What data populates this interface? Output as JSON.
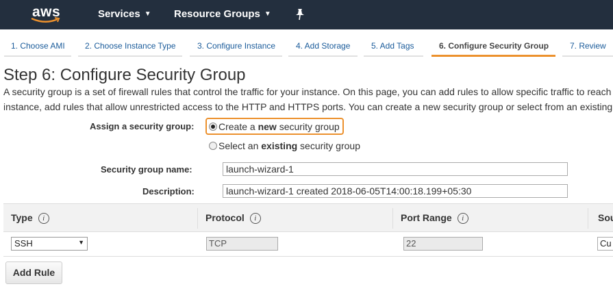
{
  "brand": {
    "logo_text": "aws",
    "accent_color": "#ec912d",
    "nav_bg": "#232f3e"
  },
  "topnav": {
    "services": "Services",
    "resource_groups": "Resource Groups",
    "pin_icon": "pin-icon"
  },
  "tabs": [
    {
      "label": "1. Choose AMI"
    },
    {
      "label": "2. Choose Instance Type"
    },
    {
      "label": "3. Configure Instance"
    },
    {
      "label": "4. Add Storage"
    },
    {
      "label": "5. Add Tags"
    },
    {
      "label": "6. Configure Security Group",
      "active": true
    },
    {
      "label": "7. Review"
    }
  ],
  "page": {
    "title": "Step 6: Configure Security Group",
    "desc_line1": "A security group is a set of firewall rules that control the traffic for your instance. On this page, you can add rules to allow specific traffic to reach",
    "desc_line2": "instance, add rules that allow unrestricted access to the HTTP and HTTPS ports. You can create a new security group or select from an existing"
  },
  "form": {
    "assign_label": "Assign a security group:",
    "option_new": {
      "pre": "Create a ",
      "bold": "new",
      "post": " security group",
      "checked": true
    },
    "option_existing": {
      "pre": "Select an ",
      "bold": "existing",
      "post": " security group",
      "checked": false
    },
    "name_label": "Security group name:",
    "name_value": "launch-wizard-1",
    "desc_label": "Description:",
    "desc_value": "launch-wizard-1 created 2018-06-05T14:00:18.199+05:30"
  },
  "rules_table": {
    "headers": {
      "type": "Type",
      "protocol": "Protocol",
      "port_range": "Port Range",
      "source": "Sou"
    },
    "info_glyph": "i",
    "rows": [
      {
        "type": "SSH",
        "protocol": "TCP",
        "port_range": "22",
        "source": "Cu"
      }
    ]
  },
  "actions": {
    "add_rule": "Add Rule"
  }
}
